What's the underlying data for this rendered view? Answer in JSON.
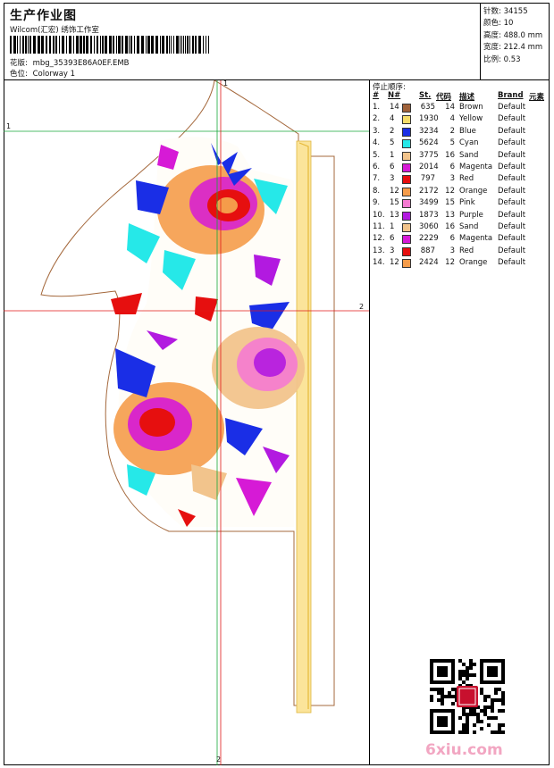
{
  "header": {
    "title": "生产作业图",
    "subtitle": "Wilcom(汇宏) 绣饰工作室",
    "design_label": "花版:",
    "design_value": "mbg_35393E86A0EF.EMB",
    "colorway_label": "色位:",
    "colorway_value": "Colorway 1"
  },
  "stats": [
    {
      "label": "针数:",
      "value": "34155"
    },
    {
      "label": "颜色:",
      "value": "10"
    },
    {
      "label": "高度:",
      "value": "488.0 mm"
    },
    {
      "label": "宽度:",
      "value": "212.4 mm"
    },
    {
      "label": "比例:",
      "value": "0.53"
    }
  ],
  "axes": {
    "vertical_top": "1",
    "vertical_bottom": "2",
    "horizontal_left": "1",
    "horizontal_right": "2"
  },
  "stop_sequence": {
    "title": "停止顺序:",
    "columns": {
      "idx": "#",
      "n": "N#",
      "st": "St.",
      "code": "代码",
      "desc": "描述",
      "brand": "Brand",
      "elem": "元素"
    },
    "rows": [
      {
        "idx": "1.",
        "n": "14",
        "color": "#a0623a",
        "st": "635",
        "code": "14",
        "desc": "Brown",
        "brand": "Default"
      },
      {
        "idx": "2.",
        "n": "4",
        "color": "#f5dd6a",
        "st": "1930",
        "code": "4",
        "desc": "Yellow",
        "brand": "Default"
      },
      {
        "idx": "3.",
        "n": "2",
        "color": "#1a2ee6",
        "st": "3234",
        "code": "2",
        "desc": "Blue",
        "brand": "Default"
      },
      {
        "idx": "4.",
        "n": "5",
        "color": "#26e8e8",
        "st": "5624",
        "code": "5",
        "desc": "Cyan",
        "brand": "Default"
      },
      {
        "idx": "5.",
        "n": "1",
        "color": "#f2c48c",
        "st": "3775",
        "code": "16",
        "desc": "Sand",
        "brand": "Default"
      },
      {
        "idx": "6.",
        "n": "6",
        "color": "#d61ad6",
        "st": "2014",
        "code": "6",
        "desc": "Magenta",
        "brand": "Default"
      },
      {
        "idx": "7.",
        "n": "3",
        "color": "#e60f0f",
        "st": "797",
        "code": "3",
        "desc": "Red",
        "brand": "Default"
      },
      {
        "idx": "8.",
        "n": "12",
        "color": "#f59c4a",
        "st": "2172",
        "code": "12",
        "desc": "Orange",
        "brand": "Default"
      },
      {
        "idx": "9.",
        "n": "15",
        "color": "#f57ad2",
        "st": "3499",
        "code": "15",
        "desc": "Pink",
        "brand": "Default"
      },
      {
        "idx": "10.",
        "n": "13",
        "color": "#b21ae0",
        "st": "1873",
        "code": "13",
        "desc": "Purple",
        "brand": "Default"
      },
      {
        "idx": "11.",
        "n": "1",
        "color": "#f2c48c",
        "st": "3060",
        "code": "16",
        "desc": "Sand",
        "brand": "Default"
      },
      {
        "idx": "12.",
        "n": "6",
        "color": "#d61ad6",
        "st": "2229",
        "code": "6",
        "desc": "Magenta",
        "brand": "Default"
      },
      {
        "idx": "13.",
        "n": "3",
        "color": "#e60f0f",
        "st": "887",
        "code": "3",
        "desc": "Red",
        "brand": "Default"
      },
      {
        "idx": "14.",
        "n": "12",
        "color": "#f59c4a",
        "st": "2424",
        "code": "12",
        "desc": "Orange",
        "brand": "Default"
      }
    ]
  },
  "watermark": {
    "site": "6xiu.com"
  },
  "icons": {
    "barcode": "barcode-icon",
    "qr": "qr-code-icon",
    "stamp": "seal-stamp-icon"
  }
}
